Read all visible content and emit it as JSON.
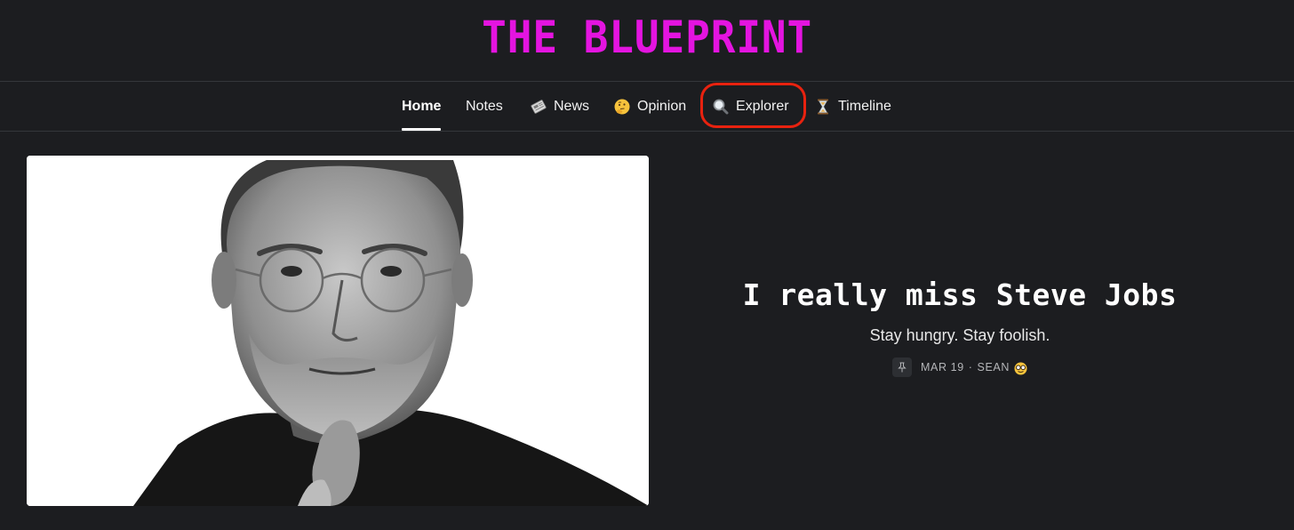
{
  "site": {
    "title": "THE BLUEPRINT",
    "title_color": "#e414e0"
  },
  "nav": {
    "items": [
      {
        "label": "Home",
        "icon": "",
        "active": true
      },
      {
        "label": "Notes",
        "icon": ""
      },
      {
        "label": "News",
        "icon": "newspaper-icon"
      },
      {
        "label": "Opinion",
        "icon": "thinking-face-icon"
      },
      {
        "label": "Explorer",
        "icon": "magnifying-glass-icon",
        "highlighted": true
      },
      {
        "label": "Timeline",
        "icon": "hourglass-icon"
      }
    ]
  },
  "featured_post": {
    "image": "steve-jobs-portrait",
    "title": "I really miss Steve Jobs",
    "subtitle": "Stay hungry. Stay foolish.",
    "meta": {
      "pin_icon": "pin-icon",
      "date": "MAR 19",
      "separator": "·",
      "author": "SEAN",
      "author_icon": "nerd-face-icon"
    }
  },
  "colors": {
    "background": "#1c1d20",
    "highlight_ring": "#e8220f"
  }
}
